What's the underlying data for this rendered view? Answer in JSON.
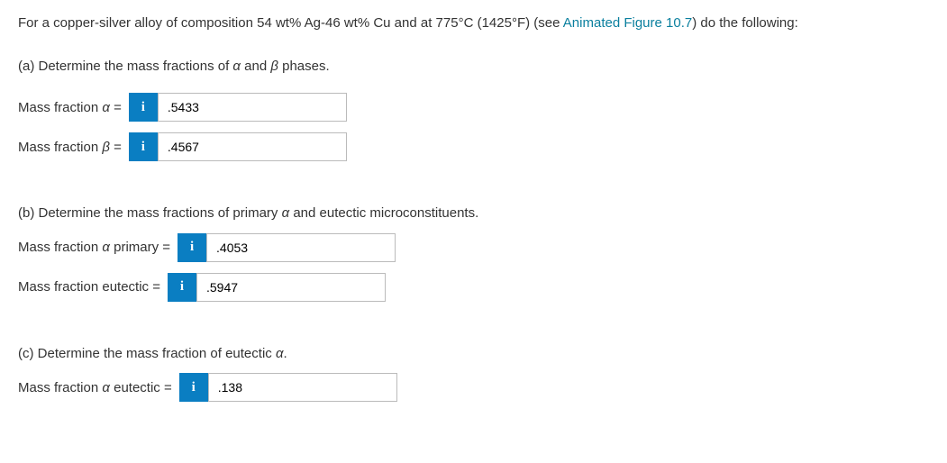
{
  "intro": {
    "prefix": "For a copper-silver alloy of composition 54 wt% Ag-46 wt% Cu and at 775°C (1425°F) (see ",
    "link_text": "Animated Figure 10.7",
    "suffix": ") do the following:"
  },
  "part_a": {
    "label_prefix": "(a) Determine the mass fractions of ",
    "alpha": "α",
    "and": " and ",
    "beta": "β",
    "label_suffix": " phases.",
    "alpha_label_prefix": "Mass fraction ",
    "alpha_label_var": "α",
    "alpha_equals": " = ",
    "alpha_value": ".5433",
    "beta_label_prefix": "Mass fraction ",
    "beta_label_var": "β",
    "beta_equals": " = ",
    "beta_value": ".4567"
  },
  "part_b": {
    "label_prefix": "(b) Determine the mass fractions of primary ",
    "alpha": "α",
    "label_suffix": " and eutectic microconstituents.",
    "primary_label_prefix": "Mass fraction ",
    "primary_label_var": "α",
    "primary_label_suffix": " primary = ",
    "primary_value": ".4053",
    "eutectic_label": "Mass fraction eutectic = ",
    "eutectic_value": ".5947"
  },
  "part_c": {
    "label_prefix": "(c) Determine the mass fraction of eutectic ",
    "alpha": "α",
    "label_suffix": ".",
    "eutectic_label_prefix": "Mass fraction ",
    "eutectic_label_var": "α",
    "eutectic_label_suffix": " eutectic = ",
    "eutectic_value": ".138"
  },
  "info_icon": "i"
}
